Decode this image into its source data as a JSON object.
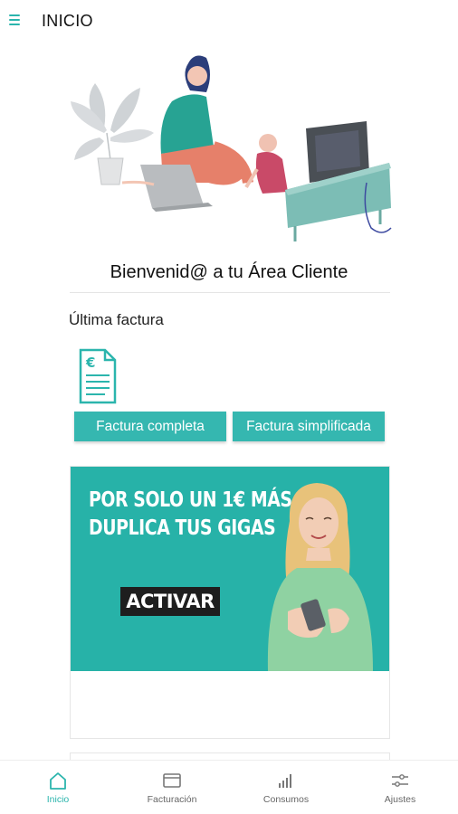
{
  "header": {
    "title": "INICIO",
    "menu_icon": "hamburger-icon"
  },
  "welcome": {
    "text": "Bienvenid@ a tu Área Cliente"
  },
  "last_invoice": {
    "title": "Última factura",
    "icon": "invoice-euro-icon",
    "buttons": {
      "full": "Factura completa",
      "simplified": "Factura simplificada"
    }
  },
  "promo": {
    "headline_line1": "POR SOLO UN 1€ MÁS",
    "headline_line2": "DUPLICA TUS GIGAS",
    "cta": "ACTIVAR"
  },
  "nav": {
    "items": [
      {
        "label": "Inicio",
        "icon": "home-icon",
        "active": true
      },
      {
        "label": "Facturación",
        "icon": "card-icon",
        "active": false
      },
      {
        "label": "Consumos",
        "icon": "bar-chart-icon",
        "active": false
      },
      {
        "label": "Ajustes",
        "icon": "sliders-icon",
        "active": false
      }
    ]
  },
  "colors": {
    "accent": "#2bb5ad",
    "button": "#35b7b0",
    "banner": "#27b2a8"
  }
}
